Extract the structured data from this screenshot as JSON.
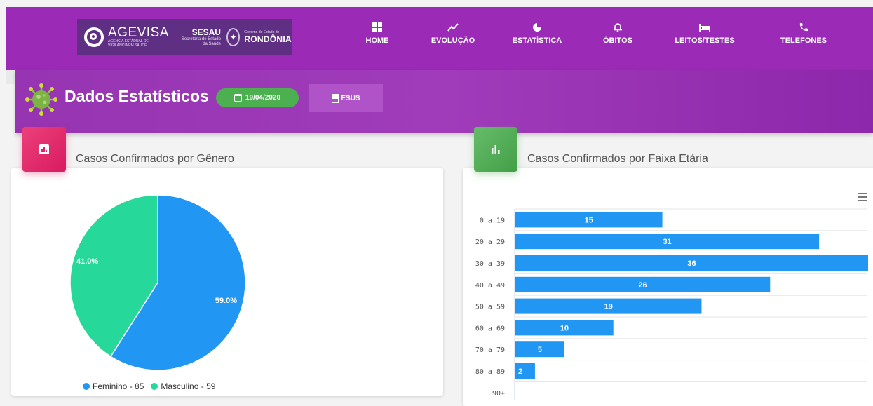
{
  "nav": {
    "logo": {
      "agevisa": "AGEVISA",
      "agevisa_sub": "AGÊNCIA ESTADUAL DE VIGILÂNCIA EM SAÚDE",
      "sesau": "SESAU",
      "sesau_sub": "Secretaria de Estado da Saúde",
      "gov_line": "Governo do Estado de",
      "state": "RONDÔNIA"
    },
    "items": [
      {
        "label": "HOME",
        "icon": "grid-icon"
      },
      {
        "label": "EVOLUÇÃO",
        "icon": "trend-icon"
      },
      {
        "label": "ESTATÍSTICA",
        "icon": "pie-chart-icon"
      },
      {
        "label": "ÓBITOS",
        "icon": "bell-icon"
      },
      {
        "label": "LEITOS/TESTES",
        "icon": "bed-icon"
      },
      {
        "label": "TELEFONES",
        "icon": "phone-icon"
      }
    ]
  },
  "header": {
    "title": "Dados Estatísticos",
    "date": "19/04/2020",
    "esus_label": "ESUS"
  },
  "colors": {
    "navbar": "#9b2bb7",
    "female": "#2196f3",
    "male": "#26d99a",
    "gender_icon": "#e91e63",
    "age_icon": "#4caf50",
    "bar": "#2196f3"
  },
  "gender_card": {
    "title": "Casos Confirmados por Gênero"
  },
  "age_card": {
    "title": "Casos Confirmados por Faixa Etária"
  },
  "legend": {
    "female": "Feminino - 85",
    "male": "Masculino - 59"
  },
  "chart_data": [
    {
      "type": "pie",
      "title": "Casos Confirmados por Gênero",
      "slices": [
        {
          "name": "Feminino",
          "value": 85,
          "percent": "59.0%"
        },
        {
          "name": "Masculino",
          "value": 59,
          "percent": "41.0%"
        }
      ]
    },
    {
      "type": "bar",
      "orientation": "horizontal",
      "title": "Casos Confirmados por Faixa Etária",
      "categories": [
        "0 a 19",
        "20 a 29",
        "30 a 39",
        "40 a 49",
        "50 a 59",
        "60 a 69",
        "70 a 79",
        "80 a 89",
        "90+"
      ],
      "values": [
        15,
        31,
        36,
        26,
        19,
        10,
        5,
        2,
        0
      ],
      "value_labels": [
        "15",
        "31",
        "36",
        "26",
        "19",
        "10",
        "5",
        "2",
        ""
      ],
      "xlim": [
        0,
        36
      ],
      "grid": true
    }
  ]
}
